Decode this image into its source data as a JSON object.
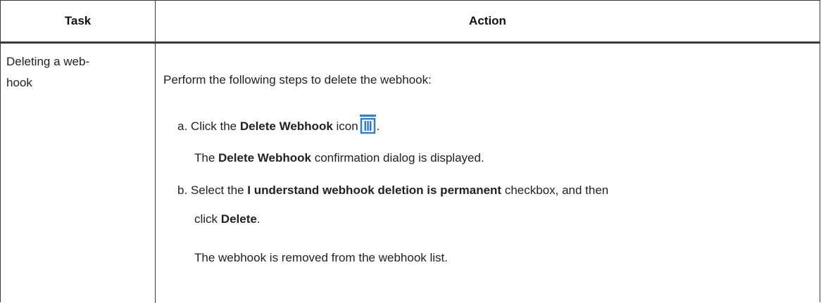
{
  "table": {
    "headers": {
      "task": "Task",
      "action": "Action"
    },
    "row": {
      "task": "Deleting a web-\nhook",
      "task_line1": "Deleting a web-",
      "task_line2": "hook",
      "intro": "Perform the following steps to delete the webhook:",
      "step_a": {
        "marker": "a.",
        "pre": "Click the",
        "bold": "Delete Webhook",
        "post": "icon",
        "icon": "trash-icon",
        "end": ".",
        "result_bold": "Delete Webhook",
        "result_post": "confirmation dialog is displayed.",
        "result_pre": "The"
      },
      "step_b": {
        "marker": "b.",
        "pre": "Select the",
        "bold": "I understand webhook deletion is permanent",
        "post": "checkbox, and then",
        "line2_pre": "click",
        "line2_bold": "Delete",
        "line2_end": ".",
        "result": "The webhook is removed from the webhook list."
      }
    }
  },
  "colors": {
    "icon": "#2f7fd0",
    "border": "#3a3a3a"
  }
}
